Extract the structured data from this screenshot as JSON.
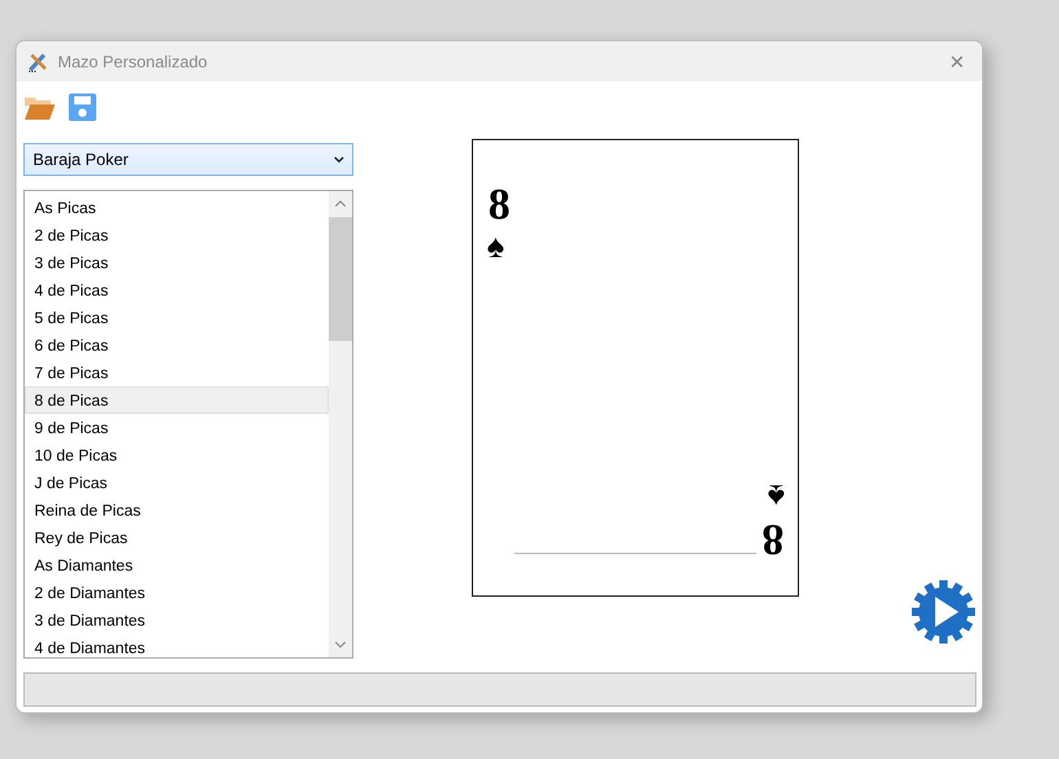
{
  "window": {
    "title": "Mazo Personalizado",
    "close": "✕"
  },
  "deck_select": {
    "value": "Baraja Poker"
  },
  "cards": [
    {
      "label": "As Picas",
      "selected": false
    },
    {
      "label": "2 de Picas",
      "selected": false
    },
    {
      "label": "3 de Picas",
      "selected": false
    },
    {
      "label": "4 de Picas",
      "selected": false
    },
    {
      "label": "5 de Picas",
      "selected": false
    },
    {
      "label": "6 de Picas",
      "selected": false
    },
    {
      "label": "7 de Picas",
      "selected": false
    },
    {
      "label": "8 de Picas",
      "selected": true
    },
    {
      "label": "9 de Picas",
      "selected": false
    },
    {
      "label": "10 de Picas",
      "selected": false
    },
    {
      "label": "J de Picas",
      "selected": false
    },
    {
      "label": "Reina de Picas",
      "selected": false
    },
    {
      "label": "Rey de Picas",
      "selected": false
    },
    {
      "label": "As Diamantes",
      "selected": false
    },
    {
      "label": "2 de Diamantes",
      "selected": false
    },
    {
      "label": "3 de Diamantes",
      "selected": false
    },
    {
      "label": "4 de Diamantes",
      "selected": false
    }
  ],
  "preview": {
    "top_corner": {
      "rank": "8",
      "suit": "♠"
    },
    "bottom_corner": {
      "rank": "8",
      "suit": "♠"
    }
  }
}
